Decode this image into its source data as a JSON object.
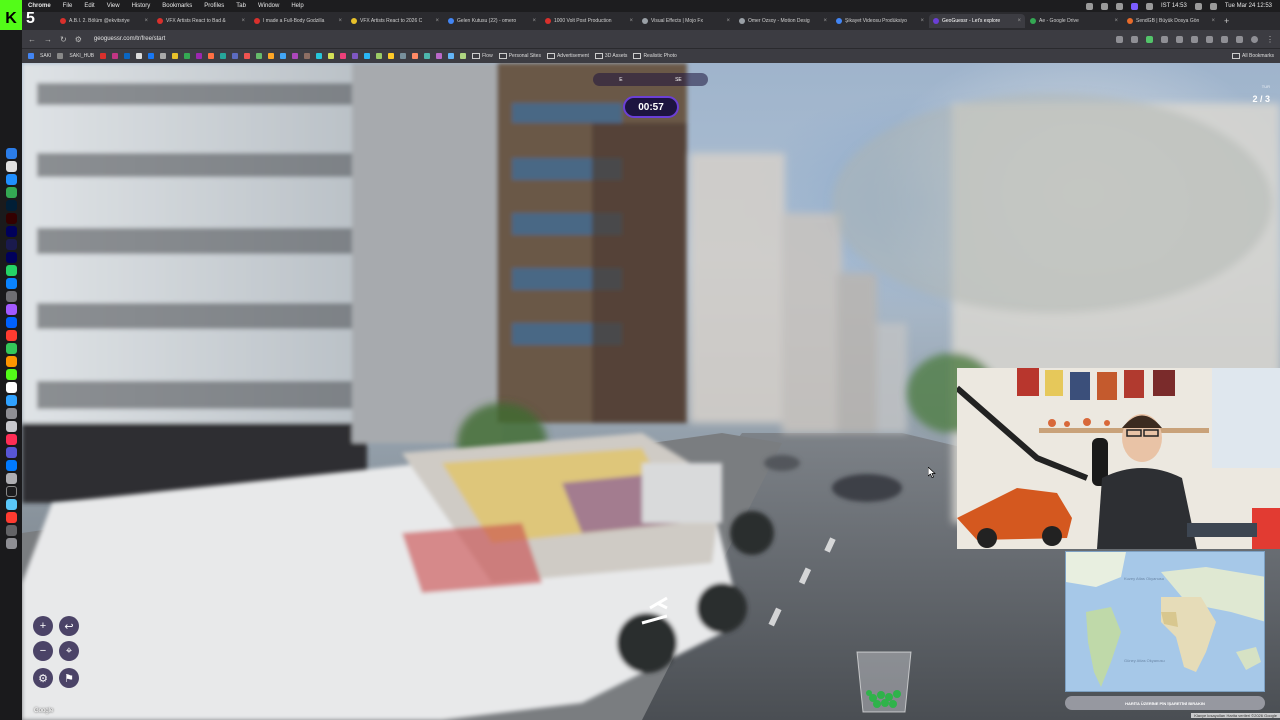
{
  "menubar": {
    "app_name": "Chrome",
    "items": [
      "File",
      "Edit",
      "View",
      "History",
      "Bookmarks",
      "Profiles",
      "Tab",
      "Window",
      "Help"
    ],
    "clock": "Tue Mar 24 12:53",
    "status_time": "IST 14:53"
  },
  "tabs": [
    {
      "title": "A.B.I. 2. Bölüm @ekvitsriye",
      "active": false
    },
    {
      "title": "VFX Artists React to Bad &",
      "active": false
    },
    {
      "title": "I made a Full-Body Godzilla",
      "active": false
    },
    {
      "title": "VFX Artists React to 2026 C",
      "active": false
    },
    {
      "title": "Gelen Kutusu (22) - omero",
      "active": false
    },
    {
      "title": "1000 Volt Post Production",
      "active": false
    },
    {
      "title": "Visual Effects | Mojo Fx",
      "active": false
    },
    {
      "title": "Omer Ozsoy - Motion Desig",
      "active": false
    },
    {
      "title": "Şikayet Videosu Prodüksiyo",
      "active": false
    },
    {
      "title": "GeoGuessr - Let's explore",
      "active": true
    },
    {
      "title": "Ae - Google Drive",
      "active": false
    },
    {
      "title": "SendGB | Büyük Dosya Gön",
      "active": false
    }
  ],
  "address": {
    "url": "geoguessr.com/tr/free/start"
  },
  "bookmarks": {
    "items": [
      "SAKI",
      "SAKI_HUB"
    ],
    "folders": [
      "Flow",
      "Personal Sites",
      "Advertisement",
      "3D Assets",
      "Realistic Photo"
    ],
    "all_bookmarks": "All Bookmarks"
  },
  "game": {
    "compass_left": "E",
    "compass_right": "SE",
    "timer": "00:57",
    "round_label": "TUR",
    "round_value": "2 / 3",
    "guess_button": "HARİTA ÜZERİNE PİN İŞARETİNİ BIRAKIN",
    "google_mark": "Google",
    "attribution": "Klavye kısayolları  Harita verileri ©2026 Google"
  },
  "minimap": {
    "labels": [
      "Kuzey Atlas Okyanusu",
      "Güney Atlas Okyanusu"
    ]
  },
  "colors": {
    "accent": "#6b3fd6",
    "hud_bg": "#1d1440",
    "kick_green": "#53fc18"
  },
  "icons": {
    "zoom_in": "plus-icon",
    "zoom_out": "minus-icon",
    "undo": "undo-icon",
    "pin": "pin-icon",
    "settings": "gear-icon",
    "flag": "flag-icon"
  }
}
